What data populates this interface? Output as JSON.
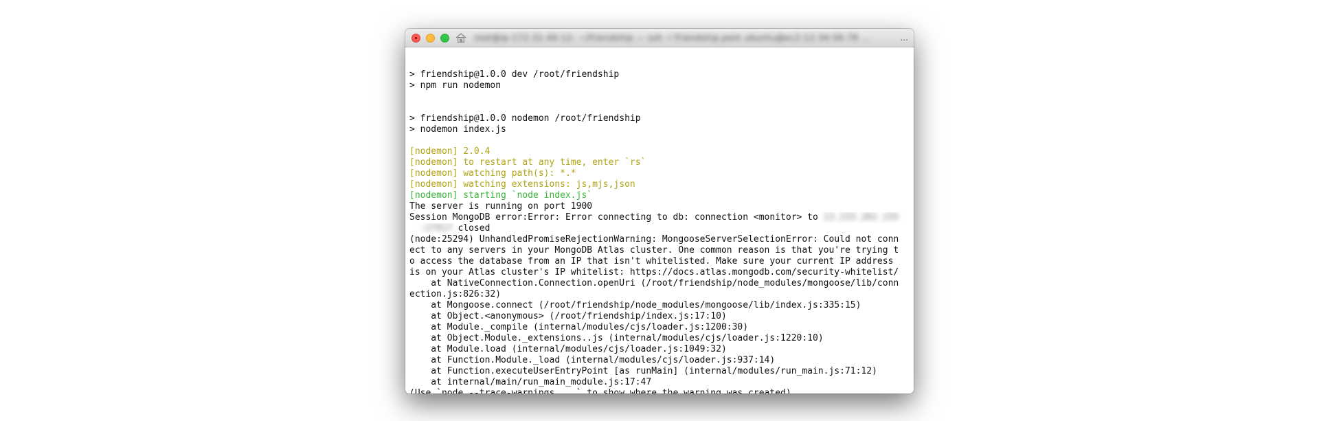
{
  "window": {
    "title_blurred": "root@ip-172-31-40-12: ~/friendship — ssh -i friendship.pem ubuntu@ec2-12-34-56-78 ...",
    "title_ellipsis": "..."
  },
  "terminal": {
    "lines": [
      {
        "text": "",
        "color": "default"
      },
      {
        "text": "> friendship@1.0.0 dev /root/friendship",
        "color": "default"
      },
      {
        "text": "> npm run nodemon",
        "color": "default"
      },
      {
        "text": "",
        "color": "default"
      },
      {
        "text": "",
        "color": "default"
      },
      {
        "text": "> friendship@1.0.0 nodemon /root/friendship",
        "color": "default"
      },
      {
        "text": "> nodemon index.js",
        "color": "default"
      },
      {
        "text": "",
        "color": "default"
      },
      {
        "text": "[nodemon] 2.0.4",
        "color": "yellow"
      },
      {
        "text": "[nodemon] to restart at any time, enter `rs`",
        "color": "yellow"
      },
      {
        "text": "[nodemon] watching path(s): *.*",
        "color": "yellow"
      },
      {
        "text": "[nodemon] watching extensions: js,mjs,json",
        "color": "yellow"
      },
      {
        "text": "[nodemon] starting `node index.js`",
        "color": "green"
      },
      {
        "text": "The server is running on port 1900",
        "color": "default"
      },
      {
        "text": "Session MongoDB error:Error: Error connecting to db: connection <monitor> to ",
        "color": "default",
        "blurred_suffix": "13.233.202.155"
      },
      {
        "text": " closed",
        "color": "default",
        "blurred_prefix": "  :27017"
      },
      {
        "text": "(node:25294) UnhandledPromiseRejectionWarning: MongooseServerSelectionError: Could not conn",
        "color": "default"
      },
      {
        "text": "ect to any servers in your MongoDB Atlas cluster. One common reason is that you're trying t",
        "color": "default"
      },
      {
        "text": "o access the database from an IP that isn't whitelisted. Make sure your current IP address",
        "color": "default"
      },
      {
        "text": "is on your Atlas cluster's IP whitelist: https://docs.atlas.mongodb.com/security-whitelist/",
        "color": "default"
      },
      {
        "text": "    at NativeConnection.Connection.openUri (/root/friendship/node_modules/mongoose/lib/conn",
        "color": "default"
      },
      {
        "text": "ection.js:826:32)",
        "color": "default"
      },
      {
        "text": "    at Mongoose.connect (/root/friendship/node_modules/mongoose/lib/index.js:335:15)",
        "color": "default"
      },
      {
        "text": "    at Object.<anonymous> (/root/friendship/index.js:17:10)",
        "color": "default"
      },
      {
        "text": "    at Module._compile (internal/modules/cjs/loader.js:1200:30)",
        "color": "default"
      },
      {
        "text": "    at Object.Module._extensions..js (internal/modules/cjs/loader.js:1220:10)",
        "color": "default"
      },
      {
        "text": "    at Module.load (internal/modules/cjs/loader.js:1049:32)",
        "color": "default"
      },
      {
        "text": "    at Function.Module._load (internal/modules/cjs/loader.js:937:14)",
        "color": "default"
      },
      {
        "text": "    at Function.executeUserEntryPoint [as runMain] (internal/modules/run_main.js:71:12)",
        "color": "default"
      },
      {
        "text": "    at internal/main/run_main_module.js:17:47",
        "color": "default"
      },
      {
        "text": "(Use `node --trace-warnings ...` to show where the warning was created)",
        "color": "default"
      }
    ]
  },
  "colors": {
    "yellow": "#b0a412",
    "green": "#3bb33b",
    "default": "#111111"
  }
}
